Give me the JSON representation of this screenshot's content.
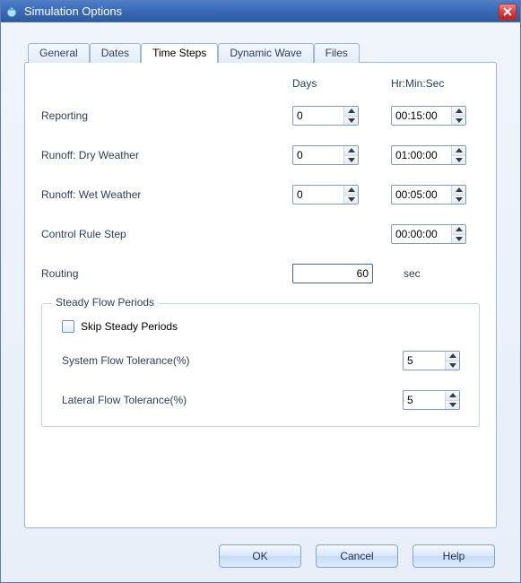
{
  "window": {
    "title": "Simulation Options"
  },
  "tabs": [
    {
      "label": "General"
    },
    {
      "label": "Dates"
    },
    {
      "label": "Time Steps"
    },
    {
      "label": "Dynamic Wave"
    },
    {
      "label": "Files"
    }
  ],
  "headers": {
    "days": "Days",
    "hms": "Hr:Min:Sec"
  },
  "rows": {
    "reporting": {
      "label": "Reporting",
      "days": "0",
      "hms": "00:15:00"
    },
    "runoff_dry": {
      "label": "Runoff: Dry Weather",
      "days": "0",
      "hms": "01:00:00"
    },
    "runoff_wet": {
      "label": "Runoff: Wet Weather",
      "days": "0",
      "hms": "00:05:00"
    },
    "control_rule": {
      "label": "Control Rule Step",
      "hms": "00:00:00"
    },
    "routing": {
      "label": "Routing",
      "value": "60",
      "unit": "sec"
    }
  },
  "group": {
    "title": "Steady Flow Periods",
    "skip_label": "Skip Steady Periods",
    "skip_checked": false,
    "system_flow": {
      "label": "System Flow Tolerance(%)",
      "value": "5"
    },
    "lateral_flow": {
      "label": "Lateral Flow Tolerance(%)",
      "value": "5"
    }
  },
  "buttons": {
    "ok": "OK",
    "cancel": "Cancel",
    "help": "Help"
  }
}
